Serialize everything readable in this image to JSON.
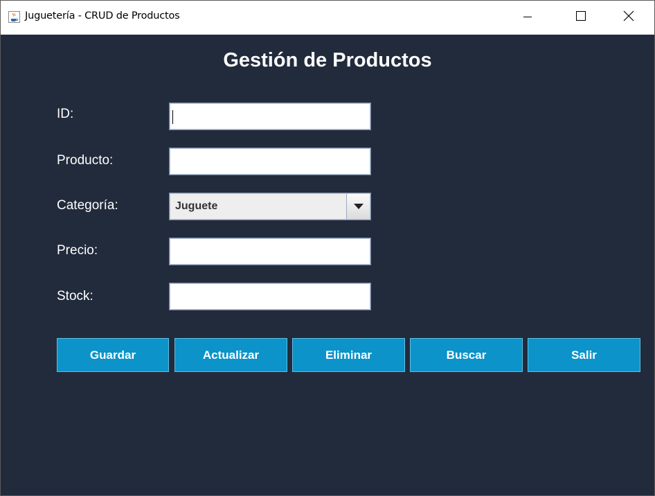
{
  "window": {
    "title": "Juguetería - CRUD de Productos",
    "icons": {
      "app": "java-cup-icon",
      "minimize": "minimize-icon",
      "maximize": "maximize-icon",
      "close": "close-icon"
    }
  },
  "form": {
    "heading": "Gestión de Productos",
    "fields": {
      "id": {
        "label": "ID:",
        "value": ""
      },
      "producto": {
        "label": "Producto:",
        "value": ""
      },
      "categoria": {
        "label": "Categoría:",
        "selected": "Juguete"
      },
      "precio": {
        "label": "Precio:",
        "value": ""
      },
      "stock": {
        "label": "Stock:",
        "value": ""
      }
    }
  },
  "buttons": {
    "guardar": "Guardar",
    "actualizar": "Actualizar",
    "eliminar": "Eliminar",
    "buscar": "Buscar",
    "salir": "Salir"
  },
  "colors": {
    "background": "#222b3c",
    "button": "#0c93c9",
    "text": "#ffffff"
  }
}
